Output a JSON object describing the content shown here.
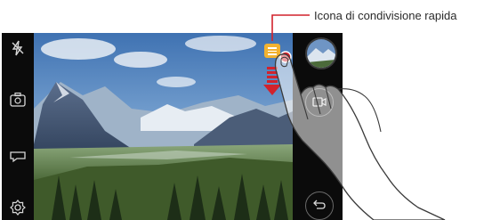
{
  "callout": {
    "label": "Icona di condivisione rapida"
  },
  "left_bar": {
    "icons": [
      "flash-off-icon",
      "switch-camera-icon",
      "mode-icon",
      "settings-icon"
    ]
  },
  "right_bar": {
    "icons": [
      "gallery-thumbnail",
      "video-record-icon",
      "back-icon"
    ]
  },
  "colors": {
    "accent_red": "#d2222c",
    "share_yellow": "#f2b230",
    "bar": "#0b0b0b"
  }
}
